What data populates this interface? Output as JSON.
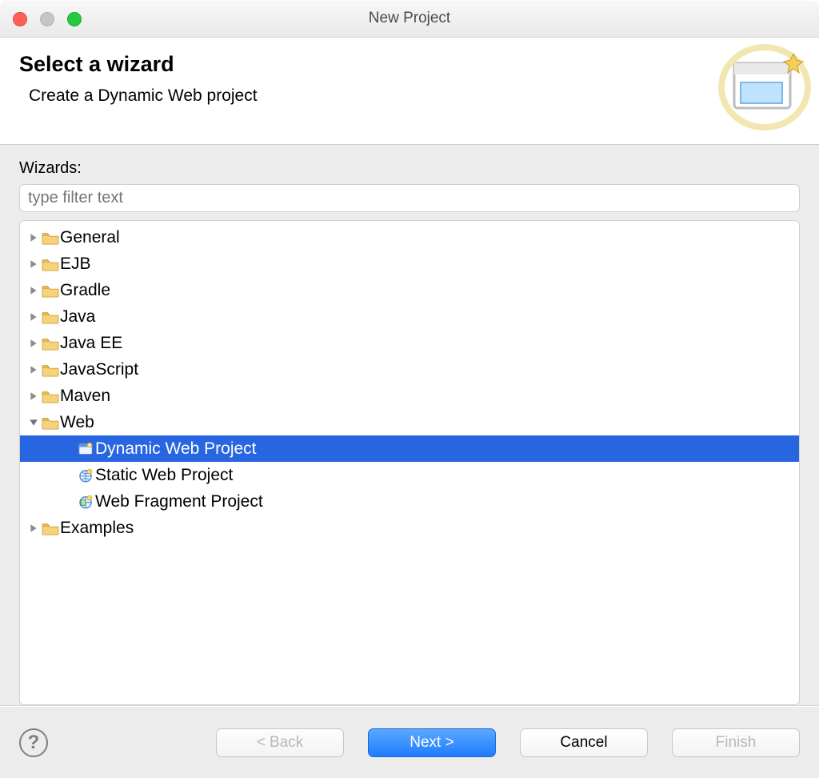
{
  "window": {
    "title": "New Project"
  },
  "banner": {
    "heading": "Select a wizard",
    "subheading": "Create a Dynamic Web project"
  },
  "filter": {
    "label": "Wizards:",
    "placeholder": "type filter text"
  },
  "tree": {
    "items": [
      {
        "label": "General",
        "icon": "folder",
        "expanded": false,
        "selected": false,
        "children": []
      },
      {
        "label": "EJB",
        "icon": "folder",
        "expanded": false,
        "selected": false,
        "children": []
      },
      {
        "label": "Gradle",
        "icon": "folder",
        "expanded": false,
        "selected": false,
        "children": []
      },
      {
        "label": "Java",
        "icon": "folder",
        "expanded": false,
        "selected": false,
        "children": []
      },
      {
        "label": "Java EE",
        "icon": "folder",
        "expanded": false,
        "selected": false,
        "children": []
      },
      {
        "label": "JavaScript",
        "icon": "folder",
        "expanded": false,
        "selected": false,
        "children": []
      },
      {
        "label": "Maven",
        "icon": "folder",
        "expanded": false,
        "selected": false,
        "children": []
      },
      {
        "label": "Web",
        "icon": "folder",
        "expanded": true,
        "selected": false,
        "children": [
          {
            "label": "Dynamic Web Project",
            "icon": "dynamic-web-project",
            "selected": true
          },
          {
            "label": "Static Web Project",
            "icon": "static-web-project",
            "selected": false
          },
          {
            "label": "Web Fragment Project",
            "icon": "web-fragment-project",
            "selected": false
          }
        ]
      },
      {
        "label": "Examples",
        "icon": "folder",
        "expanded": false,
        "selected": false,
        "children": []
      }
    ]
  },
  "buttons": {
    "back": {
      "label": "< Back",
      "enabled": false
    },
    "next": {
      "label": "Next >",
      "enabled": true
    },
    "cancel": {
      "label": "Cancel",
      "enabled": true
    },
    "finish": {
      "label": "Finish",
      "enabled": false
    }
  },
  "help": {
    "tooltip": "Help"
  }
}
